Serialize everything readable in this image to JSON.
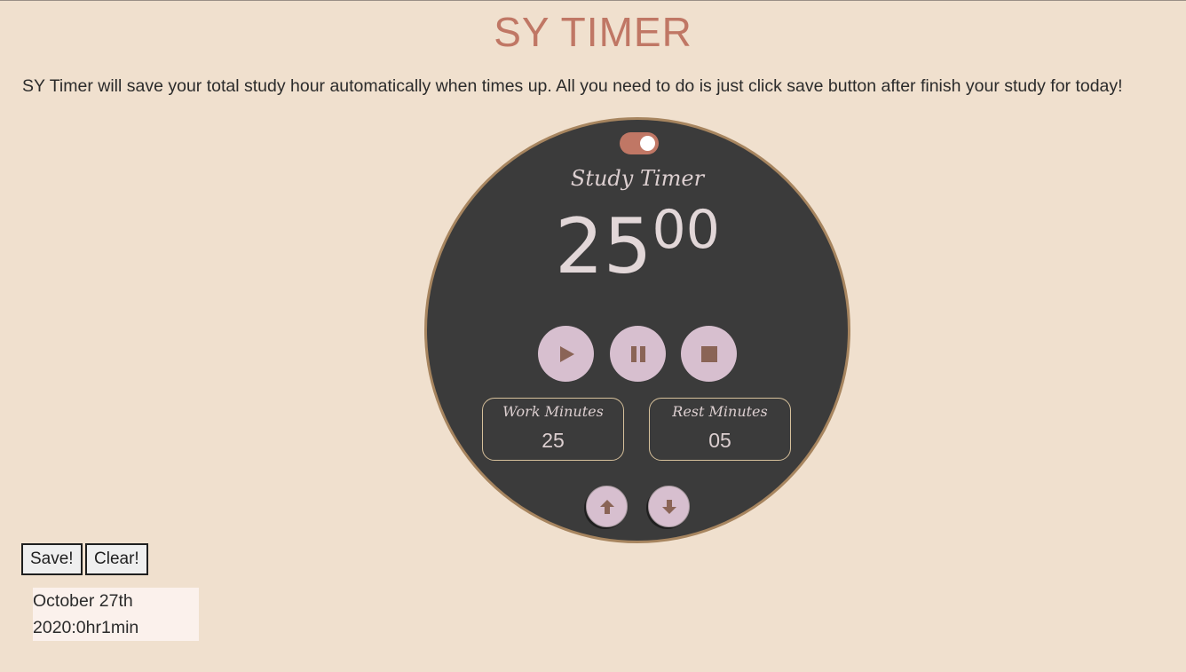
{
  "header": {
    "title": "SY TIMER",
    "intro": "SY Timer will save your total study hour automatically when times up. All you need to do is just click save button after finish your study for today!"
  },
  "timer": {
    "mode_label": "Study Timer",
    "display_minutes": "25",
    "display_seconds": "00",
    "toggle_on": true,
    "controls": [
      "play-icon",
      "pause-icon",
      "stop-icon"
    ],
    "work": {
      "label": "Work Minutes",
      "value": "25"
    },
    "rest": {
      "label": "Rest Minutes",
      "value": "05"
    },
    "adjust": [
      "arrow-up-icon",
      "arrow-down-icon"
    ]
  },
  "actions": {
    "save_label": "Save!",
    "clear_label": "Clear!"
  },
  "records": [
    {
      "line1": "October 27th",
      "line2": "2020:0hr1min"
    }
  ],
  "colors": {
    "background": "#f0e0ce",
    "accent": "#c07765",
    "circle": "#3b3b3b",
    "circle_border": "#a7855f",
    "button_fill": "#d7bfcf",
    "icon": "#8a6456"
  }
}
